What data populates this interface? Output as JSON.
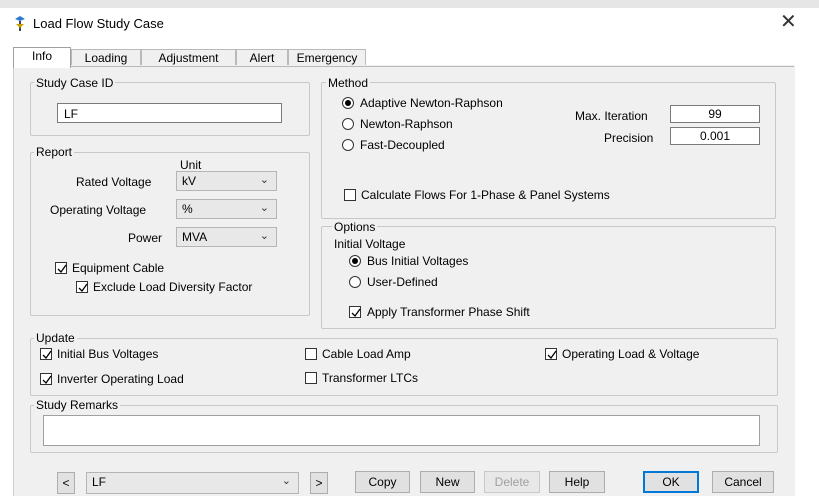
{
  "window": {
    "title": "Load Flow Study Case",
    "close_label": "✕"
  },
  "tabs": [
    {
      "label": "Info",
      "active": true
    },
    {
      "label": "Loading",
      "active": false
    },
    {
      "label": "Adjustment",
      "active": false
    },
    {
      "label": "Alert",
      "active": false
    },
    {
      "label": "Emergency",
      "active": false
    }
  ],
  "study_case": {
    "group_label": "Study Case ID",
    "value": "LF"
  },
  "report": {
    "group_label": "Report",
    "unit_header": "Unit",
    "rated_voltage": {
      "label": "Rated Voltage",
      "value": "kV"
    },
    "operating_voltage": {
      "label": "Operating Voltage",
      "value": "%"
    },
    "power": {
      "label": "Power",
      "value": "MVA"
    },
    "equipment_cable": {
      "label": "Equipment Cable",
      "checked": true
    },
    "exclude_diversity": {
      "label": "Exclude Load Diversity Factor",
      "checked": true
    }
  },
  "method": {
    "group_label": "Method",
    "options": [
      {
        "label": "Adaptive Newton-Raphson",
        "selected": true
      },
      {
        "label": "Newton-Raphson",
        "selected": false
      },
      {
        "label": "Fast-Decoupled",
        "selected": false
      }
    ],
    "max_iteration": {
      "label": "Max. Iteration",
      "value": "99"
    },
    "precision": {
      "label": "Precision",
      "value": "0.001"
    },
    "calc_flows": {
      "label": "Calculate Flows For 1-Phase & Panel Systems",
      "checked": false
    }
  },
  "options": {
    "group_label": "Options",
    "initial_voltage_label": "Initial Voltage",
    "bus_initial": {
      "label": "Bus Initial Voltages",
      "selected": true
    },
    "user_defined": {
      "label": "User-Defined",
      "selected": false
    },
    "apply_transformer": {
      "label": "Apply Transformer Phase Shift",
      "checked": true
    }
  },
  "update": {
    "group_label": "Update",
    "initial_bus_voltages": {
      "label": "Initial Bus Voltages",
      "checked": true
    },
    "cable_load_amp": {
      "label": "Cable Load Amp",
      "checked": false
    },
    "operating_load_voltage": {
      "label": "Operating Load & Voltage",
      "checked": true
    },
    "inverter_operating_load": {
      "label": "Inverter Operating Load",
      "checked": true
    },
    "transformer_ltcs": {
      "label": "Transformer LTCs",
      "checked": false
    }
  },
  "remarks": {
    "group_label": "Study Remarks",
    "value": ""
  },
  "footer": {
    "prev_label": "<",
    "next_label": ">",
    "case_select": "LF",
    "copy": "Copy",
    "new": "New",
    "delete": "Delete",
    "help": "Help",
    "ok": "OK",
    "cancel": "Cancel"
  },
  "colors": {
    "accent": "#0078d7",
    "dialog_bg": "#f0f0f0",
    "icon_accent": "#c8a000"
  }
}
